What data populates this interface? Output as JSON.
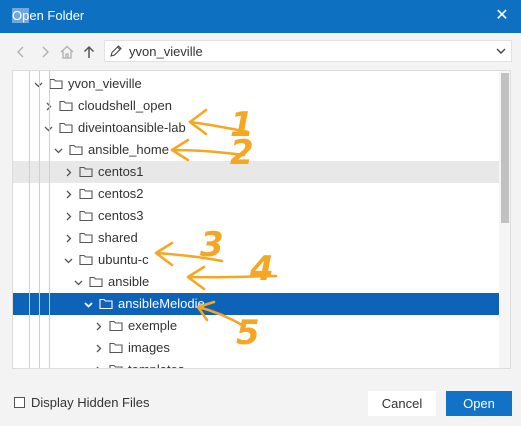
{
  "dialog": {
    "title_selected": "Op",
    "title_rest": "en Folder",
    "close_glyph": "✕"
  },
  "nav": {
    "back_icon": "chevron-left-icon",
    "forward_icon": "chevron-right-icon",
    "home_icon": "home-icon",
    "up_icon": "arrow-up-icon",
    "path_value": "yvon_vieville"
  },
  "tree": {
    "items": [
      {
        "label": "yvon_vieville",
        "expanded": true,
        "depth": 0
      },
      {
        "label": "cloudshell_open",
        "expanded": false,
        "depth": 1
      },
      {
        "label": "diveintoansible-lab",
        "expanded": true,
        "depth": 1
      },
      {
        "label": "ansible_home",
        "expanded": true,
        "depth": 2
      },
      {
        "label": "centos1",
        "expanded": false,
        "depth": 3,
        "state": "hover"
      },
      {
        "label": "centos2",
        "expanded": false,
        "depth": 3
      },
      {
        "label": "centos3",
        "expanded": false,
        "depth": 3
      },
      {
        "label": "shared",
        "expanded": false,
        "depth": 3
      },
      {
        "label": "ubuntu-c",
        "expanded": true,
        "depth": 3
      },
      {
        "label": "ansible",
        "expanded": true,
        "depth": 4
      },
      {
        "label": "ansibleMelodie",
        "expanded": true,
        "depth": 5,
        "state": "selected"
      },
      {
        "label": "exemple",
        "expanded": false,
        "depth": 6
      },
      {
        "label": "images",
        "expanded": false,
        "depth": 6
      },
      {
        "label": "templates",
        "expanded": false,
        "depth": 6
      }
    ]
  },
  "annotations": {
    "color": "#f5a623",
    "numbers": [
      "1",
      "2",
      "3",
      "4",
      "5"
    ]
  },
  "footer": {
    "hidden_files_label": "Display Hidden Files",
    "hidden_files_checked": false,
    "cancel_label": "Cancel",
    "open_label": "Open"
  },
  "colors": {
    "titlebar": "#0e70c0",
    "selection": "#0e62b8",
    "hover": "#e8e8e8",
    "primary_button": "#1273c6"
  }
}
